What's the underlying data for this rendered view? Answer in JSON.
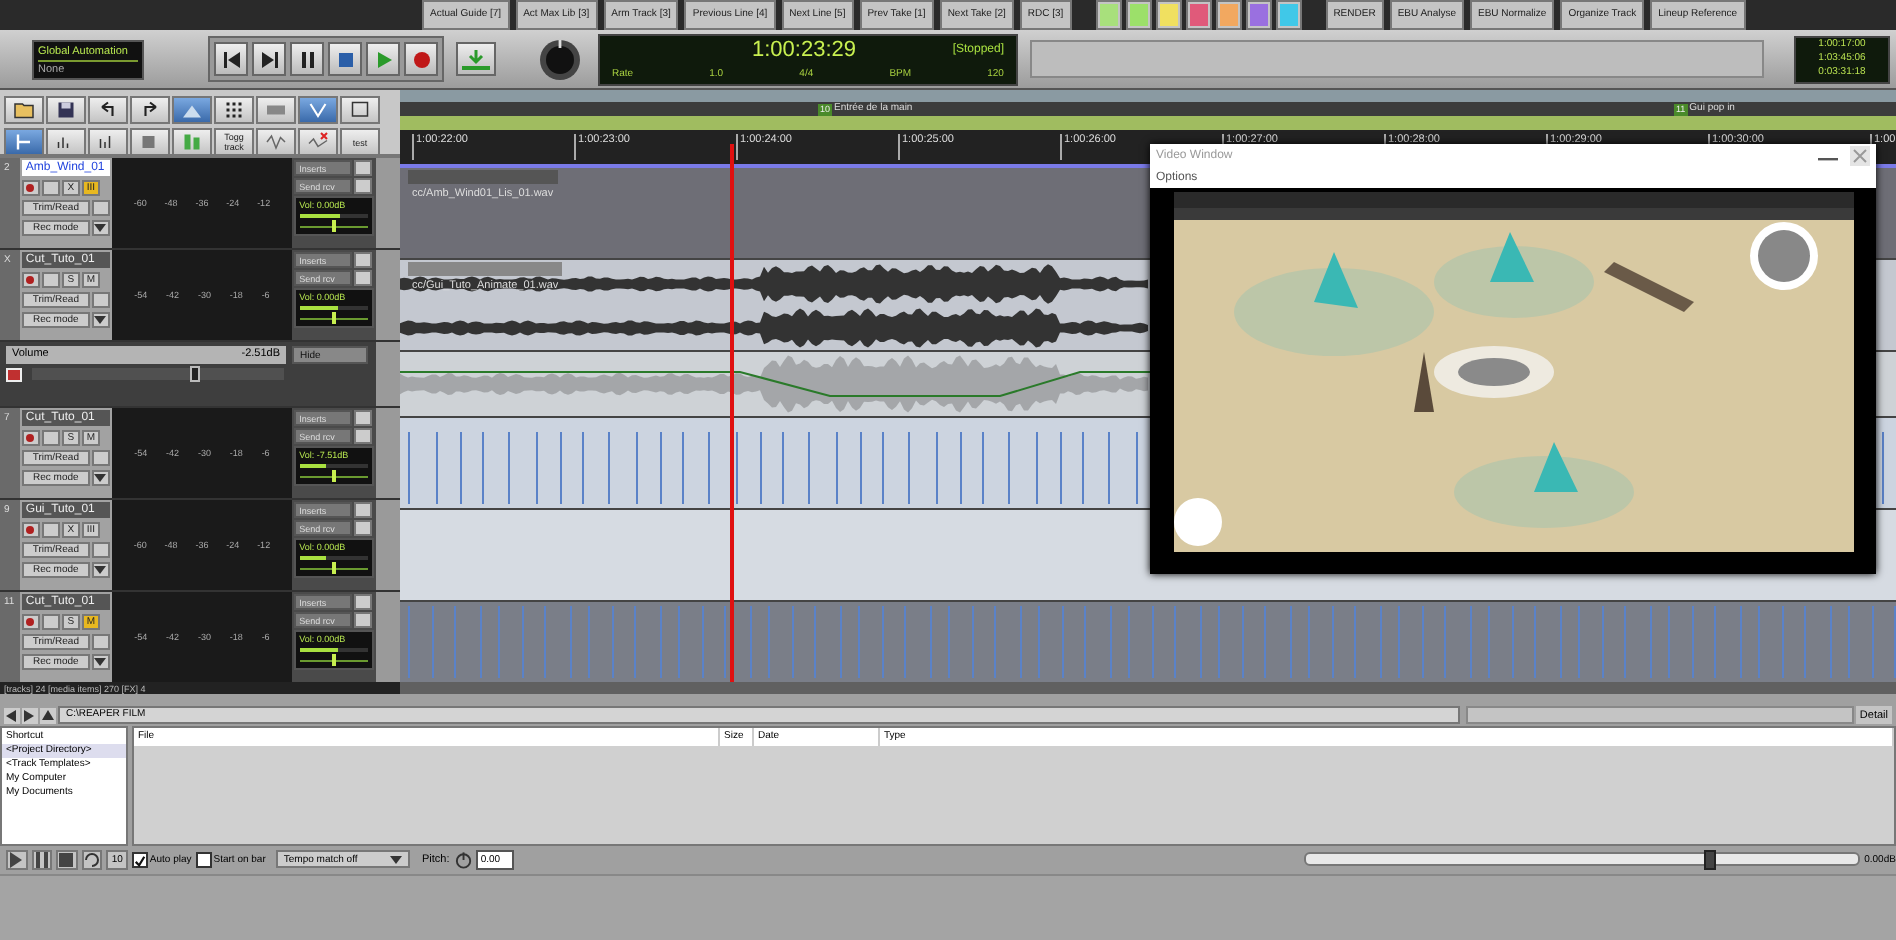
{
  "action_bar": {
    "buttons": [
      "Actual Guide [7]",
      "Act Max Lib [3]",
      "Arm Track [3]",
      "Previous Line [4]",
      "Next Line [5]",
      "Prev Take [1]",
      "Next Take [2]",
      "RDC [3]"
    ],
    "swatches": [
      {
        "color": "#a8e07c"
      },
      {
        "color": "#9ce06a"
      },
      {
        "color": "#f0e060"
      },
      {
        "color": "#e05a7a"
      },
      {
        "color": "#f2a860"
      },
      {
        "color": "#9a70e0"
      },
      {
        "color": "#40c8e8"
      }
    ],
    "buttons_right": [
      "RENDER",
      "EBU Analyse",
      "EBU Normalize",
      "Organize Track",
      "Lineup Reference"
    ]
  },
  "transport": {
    "automation_title": "Global Automation",
    "automation_mode": "None",
    "time": "1:00:23:29",
    "state": "[Stopped]",
    "rate_label": "Rate",
    "rate": "1.0",
    "signature": "4/4",
    "bpm_label": "BPM",
    "bpm": "120"
  },
  "side_clock": [
    "1:00:17:00",
    "1:03:45:06",
    "0:03:31:18"
  ],
  "tools": [
    {
      "on": false
    },
    {
      "on": false
    },
    {
      "on": false
    },
    {
      "on": false
    },
    {
      "on": true
    },
    {
      "on": false
    },
    {
      "on": false
    },
    {
      "on": true
    },
    {
      "on": false
    },
    {
      "on": true
    },
    {
      "on": false
    },
    {
      "on": false
    },
    {
      "on": false
    },
    {
      "on": false
    },
    {
      "on": false,
      "label": "Togg track"
    },
    {
      "on": false
    },
    {
      "on": false
    },
    {
      "on": false,
      "label": "test"
    }
  ],
  "tracks": [
    {
      "kind": "track",
      "number": "2",
      "name": "Amb_Wind_01",
      "selected": true,
      "buttons": [
        {
          "label": "X",
          "on": false
        },
        {
          "label": "III",
          "on": true
        }
      ],
      "automation_mode": "Trim/Read",
      "rec_mode": "Rec mode",
      "ticks": [
        "-60",
        "-48",
        "-36",
        "-24",
        "-12"
      ],
      "inserts": "Inserts",
      "sends": "Send rcv",
      "volume": "Vol: 0.00dB",
      "level": 0.6,
      "pan": {
        "level": 0.5
      },
      "clip": "cc/Amb_Wind01_Lis_01.wav"
    },
    {
      "kind": "track",
      "number": "X",
      "name": "Cut_Tuto_01",
      "selected": false,
      "buttons": [
        {
          "label": "S",
          "on": false
        },
        {
          "label": "M",
          "on": false
        }
      ],
      "automation_mode": "Trim/Read",
      "rec_mode": "Rec mode",
      "ticks": [
        "-54",
        "-42",
        "-30",
        "-18",
        "-6"
      ],
      "inserts": "Inserts",
      "sends": "Send rcv",
      "volume": "Vol: 0.00dB",
      "level": 0.55,
      "pan": {
        "level": 0.5
      },
      "clip": "cc/Gui_Tuto_Animate_01.wav"
    },
    {
      "kind": "envelope",
      "name": "Volume",
      "reading": "-2.51dB",
      "mode": "Hide",
      "level": 0.63
    },
    {
      "kind": "track",
      "number": "7",
      "name": "Cut_Tuto_01",
      "selected": false,
      "buttons": [
        {
          "label": "S",
          "on": false
        },
        {
          "label": "M",
          "on": false
        }
      ],
      "automation_mode": "Trim/Read",
      "rec_mode": "Rec mode",
      "ticks": [
        "-54",
        "-42",
        "-30",
        "-18",
        "-6"
      ],
      "inserts": "Inserts",
      "sends": "Send rcv",
      "volume": "Vol: -7.51dB",
      "level": 0.4,
      "pan": {
        "level": 0.5
      }
    },
    {
      "kind": "track",
      "number": "9",
      "name": "Gui_Tuto_01",
      "selected": false,
      "buttons": [
        {
          "label": "X",
          "on": false
        },
        {
          "label": "III",
          "on": false
        }
      ],
      "automation_mode": "Trim/Read",
      "rec_mode": "Rec mode",
      "ticks": [
        "-60",
        "-48",
        "-36",
        "-24",
        "-12"
      ],
      "inserts": "Inserts",
      "sends": "Send rcv",
      "volume": "Vol: 0.00dB",
      "level": 0.4,
      "pan": {
        "level": 0.5
      }
    },
    {
      "kind": "track",
      "number": "11",
      "name": "Cut_Tuto_01",
      "selected": false,
      "buttons": [
        {
          "label": "S",
          "on": false
        },
        {
          "label": "M",
          "on": true
        }
      ],
      "automation_mode": "Trim/Read",
      "rec_mode": "Rec mode",
      "ticks": [
        "-54",
        "-42",
        "-30",
        "-18",
        "-6"
      ],
      "inserts": "Inserts",
      "sends": "Send rcv",
      "volume": "Vol: 0.00dB",
      "level": 0.55,
      "pan": {
        "level": 0.5
      }
    }
  ],
  "status": "[tracks] 24 [media items] 270 [FX] 4",
  "markers": [
    {
      "number": "10",
      "label": "Entrée de la main"
    },
    {
      "number": "11",
      "label": "Gui pop in"
    }
  ],
  "ruler": [
    "1:00:22:00",
    "1:00:23:00",
    "1:00:24:00",
    "1:00:25:00",
    "1:00:26:00",
    "1:00:27:00",
    "1:00:28:00",
    "1:00:29:00",
    "1:00:30:00",
    "1:00"
  ],
  "video_window": {
    "title": "Video Window",
    "menu": "Options"
  },
  "browser": {
    "path": "C:\\REAPER FILM",
    "details": "Detail",
    "shortcut_header": "Shortcut",
    "shortcuts": [
      {
        "label": "<Project Directory>",
        "selected": true
      },
      {
        "label": "<Track Templates>",
        "selected": false
      },
      {
        "label": "My Computer",
        "selected": false
      },
      {
        "label": "My Documents",
        "selected": false
      }
    ],
    "columns": [
      "File",
      "Size",
      "Date",
      "Type"
    ],
    "loop": "10",
    "auto_play": {
      "label": "Auto play",
      "checked": true
    },
    "start_on_bar": {
      "label": "Start on bar",
      "checked": false
    },
    "tempo": "Tempo match off",
    "pitch_label": "Pitch:",
    "pitch": "0.00",
    "volume": {
      "level": 0.72,
      "reading": "0.00dB"
    }
  }
}
